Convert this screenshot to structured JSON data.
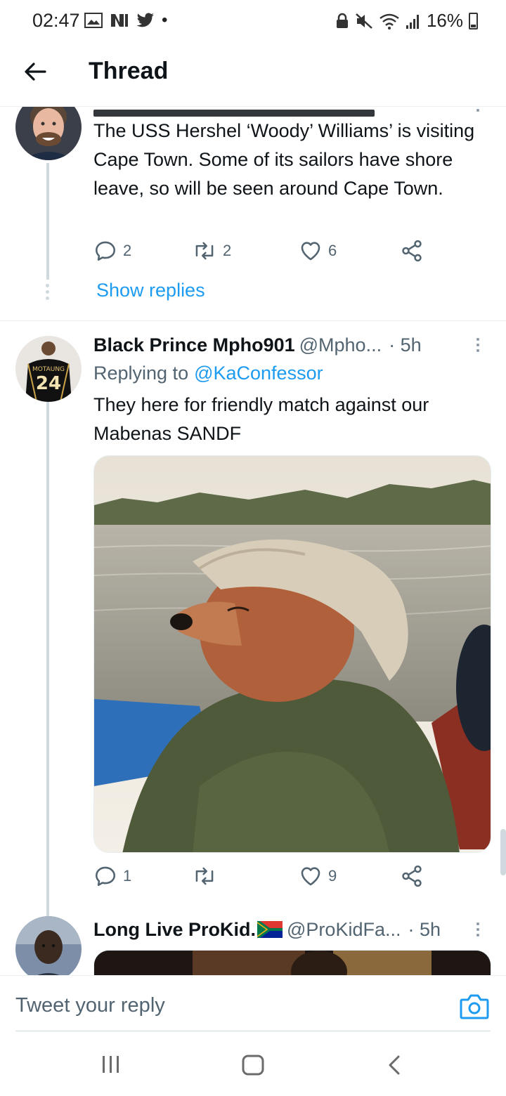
{
  "status_bar": {
    "time": "02:47",
    "battery": "16%"
  },
  "header": {
    "title": "Thread"
  },
  "tweets": [
    {
      "text": "The USS Hershel ‘Woody’ Williams’ is visiting Cape Town. Some of its sailors have shore leave, so will be seen around Cape Town.",
      "replies": "2",
      "retweets": "2",
      "likes": "6",
      "show_replies": "Show replies"
    },
    {
      "name": "Black Prince Mpho901",
      "handle": "@Mpho...",
      "time": "· 5h",
      "replying_prefix": "Replying to",
      "replying_handle": "@KaConfessor",
      "text": "They here for friendly match against our Mabenas SANDF",
      "replies": "1",
      "retweets": "",
      "likes": "9",
      "avatar_jersey": {
        "name": "MOTAUNG",
        "number": "24"
      }
    },
    {
      "name": "Long Live ProKid.",
      "handle": "@ProKidFa...",
      "time": "· 5h"
    }
  ],
  "reply_bar": {
    "placeholder": "Tweet your reply"
  },
  "colors": {
    "accent": "#1d9bf0",
    "secondary_text": "#536471",
    "thread_line": "#cfd9de"
  }
}
